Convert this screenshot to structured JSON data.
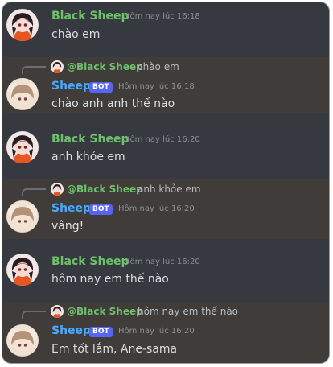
{
  "colors": {
    "background": "#36393f",
    "reply_background": "#3f3c3a",
    "black_sheep_name": "#6ec06a",
    "sheep_name": "#4aa9ff",
    "bot_badge": "#5865f2"
  },
  "messages": [
    {
      "author": "Black Sheep",
      "timestamp": "Hôm nay lúc 16:18",
      "text": "chào em",
      "avatar": "black-sheep-avatar-icon"
    },
    {
      "author": "Sheep",
      "badge": "BOT",
      "timestamp": "Hôm nay lúc 16:18",
      "text": "chào anh anh thế nào",
      "reply": {
        "author": "@Black Sheep",
        "text": "chào em"
      },
      "avatar": "sheep-avatar-icon"
    },
    {
      "author": "Black Sheep",
      "timestamp": "Hôm nay lúc 16:20",
      "text": "anh khỏe em",
      "avatar": "black-sheep-avatar-icon"
    },
    {
      "author": "Sheep",
      "badge": "BOT",
      "timestamp": "Hôm nay lúc 16:20",
      "text": "vâng!",
      "reply": {
        "author": "@Black Sheep",
        "text": "anh khỏe em"
      },
      "avatar": "sheep-avatar-icon"
    },
    {
      "author": "Black Sheep",
      "timestamp": "Hôm nay lúc 16:20",
      "text": "hôm nay em thế nào",
      "avatar": "black-sheep-avatar-icon"
    },
    {
      "author": "Sheep",
      "badge": "BOT",
      "timestamp": "Hôm nay lúc 16:20",
      "text": "Em tốt lắm, Ane-sama",
      "reply": {
        "author": "@Black Sheep",
        "text": "hôm nay em thế nào"
      },
      "avatar": "sheep-avatar-icon"
    }
  ]
}
